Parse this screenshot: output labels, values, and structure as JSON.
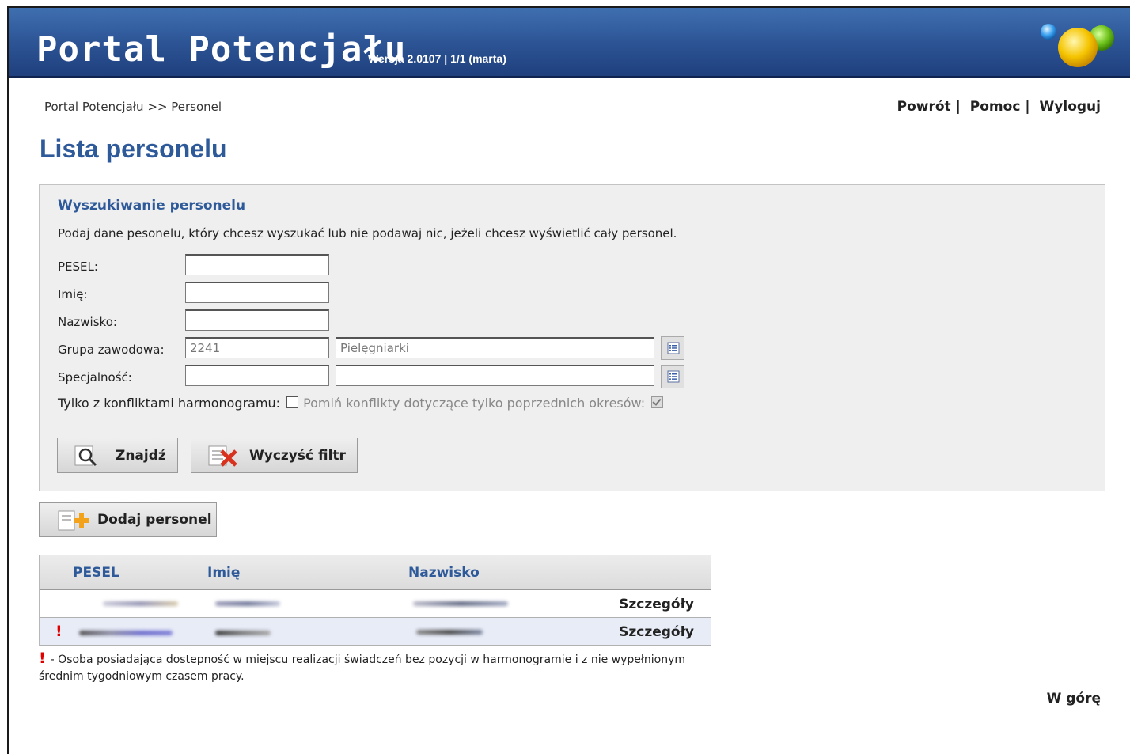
{
  "header": {
    "app_title": "Portal Potencjału",
    "version": "Wersja 2.0107 | 1/1 (marta)"
  },
  "breadcrumb": "Portal Potencjału >> Personel",
  "toplinks": {
    "back": "Powrót",
    "help": "Pomoc",
    "logout": "Wyloguj",
    "separator": "|"
  },
  "page_title": "Lista personelu",
  "search": {
    "title": "Wyszukiwanie personelu",
    "description": "Podaj dane pesonelu, który chcesz wyszukać lub nie podawaj nic, jeżeli chcesz wyświetlić cały personel.",
    "fields": {
      "pesel": {
        "label": "PESEL:",
        "value": ""
      },
      "first_name": {
        "label": "Imię:",
        "value": ""
      },
      "last_name": {
        "label": "Nazwisko:",
        "value": ""
      },
      "professional_group": {
        "label": "Grupa zawodowa:",
        "code": "2241",
        "name": "Pielęgniarki"
      },
      "specialty": {
        "label": "Specjalność:",
        "code": "",
        "name": ""
      }
    },
    "conflicts_label": "Tylko z konfliktami harmonogramu:",
    "conflicts_checked": false,
    "skip_previous_label": "Pomiń konflikty dotyczące tylko poprzednich okresów:",
    "skip_previous_checked": true,
    "find_button": "Znajdź",
    "clear_button": "Wyczyść filtr"
  },
  "add_button": "Dodaj personel",
  "table": {
    "columns": [
      "PESEL",
      "Imię",
      "Nazwisko"
    ],
    "rows": [
      {
        "warning": false,
        "details": "Szczegóły"
      },
      {
        "warning": true,
        "warning_mark": "!",
        "details": "Szczegóły"
      }
    ]
  },
  "note": {
    "mark": "!",
    "text": "- Osoba posiadająca dostepność w miejscu realizacji świadczeń bez pozycji w harmonogramie i z nie wypełnionym średnim tygodniowym czasem pracy."
  },
  "back_to_top": "W górę"
}
